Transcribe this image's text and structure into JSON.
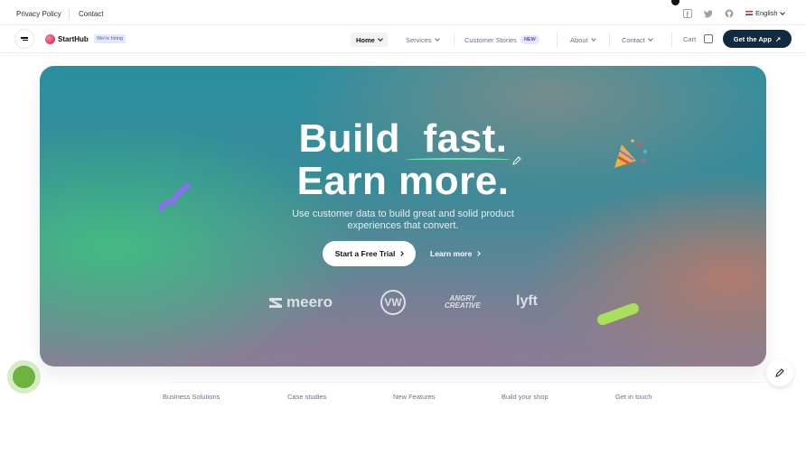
{
  "topbar": {
    "links": [
      "Privacy Policy",
      "Contact"
    ],
    "social_icons": [
      "facebook-icon",
      "twitter-icon",
      "github-icon"
    ],
    "language": "English"
  },
  "nav": {
    "brand": "StartHub",
    "hiring_badge": "We're hiring",
    "items": [
      {
        "label": "Home",
        "active": true
      },
      {
        "label": "Services"
      },
      {
        "label": "Customer Stories",
        "badge": "NEW"
      },
      {
        "label": "About"
      },
      {
        "label": "Contact"
      }
    ],
    "cart_label": "Cart",
    "cta": "Get the App"
  },
  "hero": {
    "line1_a": "Build",
    "line1_b": "fast.",
    "line2": "Earn more.",
    "subtitle": "Use customer data to build great and solid product experiences that convert.",
    "primary_cta": "Start a Free Trial",
    "secondary_cta": "Learn more",
    "logos": {
      "meero": "meero",
      "vw": "VW",
      "angry_1": "ANGRY",
      "angry_2": "CREATIVE",
      "lyft": "lyft"
    }
  },
  "footer_links": [
    "Business Solutions",
    "Case studies",
    "New Features",
    "Build your shop",
    "Get in touch"
  ],
  "colors": {
    "accent_dark": "#102a3e",
    "badge_bg": "#e5e7fb",
    "badge_text": "#4e5ad1",
    "underline": "#5ee3a8",
    "chat_green": "#6db33f"
  }
}
